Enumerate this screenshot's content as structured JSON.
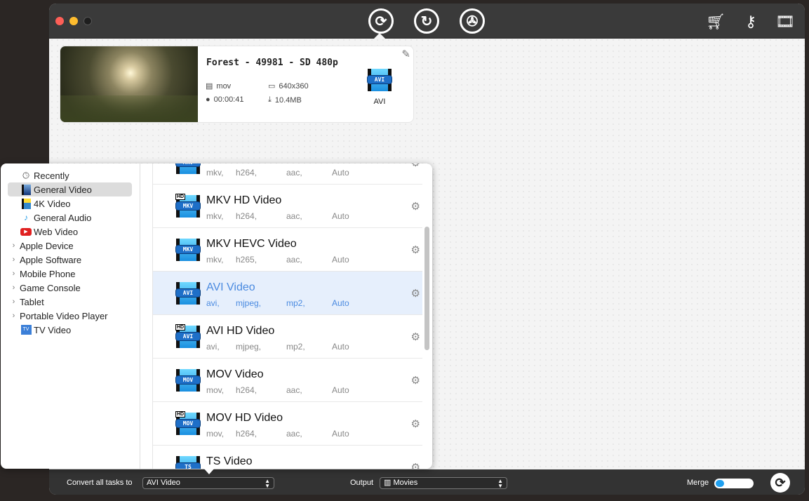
{
  "toolbar": {
    "icons": [
      "convert-icon",
      "rotate-edit-icon",
      "film-reel-icon"
    ],
    "right_icons": [
      "cart-icon",
      "key-icon",
      "video-music-icon"
    ]
  },
  "task": {
    "title": "Forest - 49981 - SD 480p",
    "container": "mov",
    "resolution": "640x360",
    "duration": "00:00:41",
    "size": "10.4MB",
    "target_format": "AVI",
    "target_badge": "AVI"
  },
  "sidebar": {
    "items": [
      {
        "label": "Recently",
        "icon": "clock-icon"
      },
      {
        "label": "General Video",
        "icon": "film-icon",
        "selected": true
      },
      {
        "label": "4K Video",
        "icon": "4k-film-icon"
      },
      {
        "label": "General Audio",
        "icon": "music-note-icon"
      },
      {
        "label": "Web Video",
        "icon": "youtube-icon"
      },
      {
        "label": "Apple Device",
        "expandable": true
      },
      {
        "label": "Apple Software",
        "expandable": true
      },
      {
        "label": "Mobile Phone",
        "expandable": true
      },
      {
        "label": "Game Console",
        "expandable": true
      },
      {
        "label": "Tablet",
        "expandable": true
      },
      {
        "label": "Portable Video Player",
        "expandable": true
      },
      {
        "label": "TV Video",
        "icon": "tv-icon"
      }
    ]
  },
  "formats": [
    {
      "name": "",
      "badge": "MKV",
      "hd": false,
      "specs": [
        "mkv,",
        "h264,",
        "aac,",
        "Auto"
      ]
    },
    {
      "name": "MKV HD Video",
      "badge": "MKV",
      "hd": true,
      "specs": [
        "mkv,",
        "h264,",
        "aac,",
        "Auto"
      ]
    },
    {
      "name": "MKV HEVC Video",
      "badge": "MKV",
      "hd": false,
      "specs": [
        "mkv,",
        "h265,",
        "aac,",
        "Auto"
      ]
    },
    {
      "name": "AVI Video",
      "badge": "AVI",
      "hd": false,
      "selected": true,
      "specs": [
        "avi,",
        "mjpeg,",
        "mp2,",
        "Auto"
      ]
    },
    {
      "name": "AVI HD Video",
      "badge": "AVI",
      "hd": true,
      "specs": [
        "avi,",
        "mjpeg,",
        "mp2,",
        "Auto"
      ]
    },
    {
      "name": "MOV Video",
      "badge": "MOV",
      "hd": false,
      "specs": [
        "mov,",
        "h264,",
        "aac,",
        "Auto"
      ]
    },
    {
      "name": "MOV HD Video",
      "badge": "MOV",
      "hd": true,
      "specs": [
        "mov,",
        "h264,",
        "aac,",
        "Auto"
      ]
    },
    {
      "name": "TS Video",
      "badge": "TS",
      "hd": false,
      "specs": []
    }
  ],
  "hd_label": "HD",
  "bottom": {
    "convert_label": "Convert all tasks to",
    "convert_value": "AVI Video",
    "output_label": "Output",
    "output_value": "Movies",
    "merge_label": "Merge",
    "merge_on": false
  }
}
